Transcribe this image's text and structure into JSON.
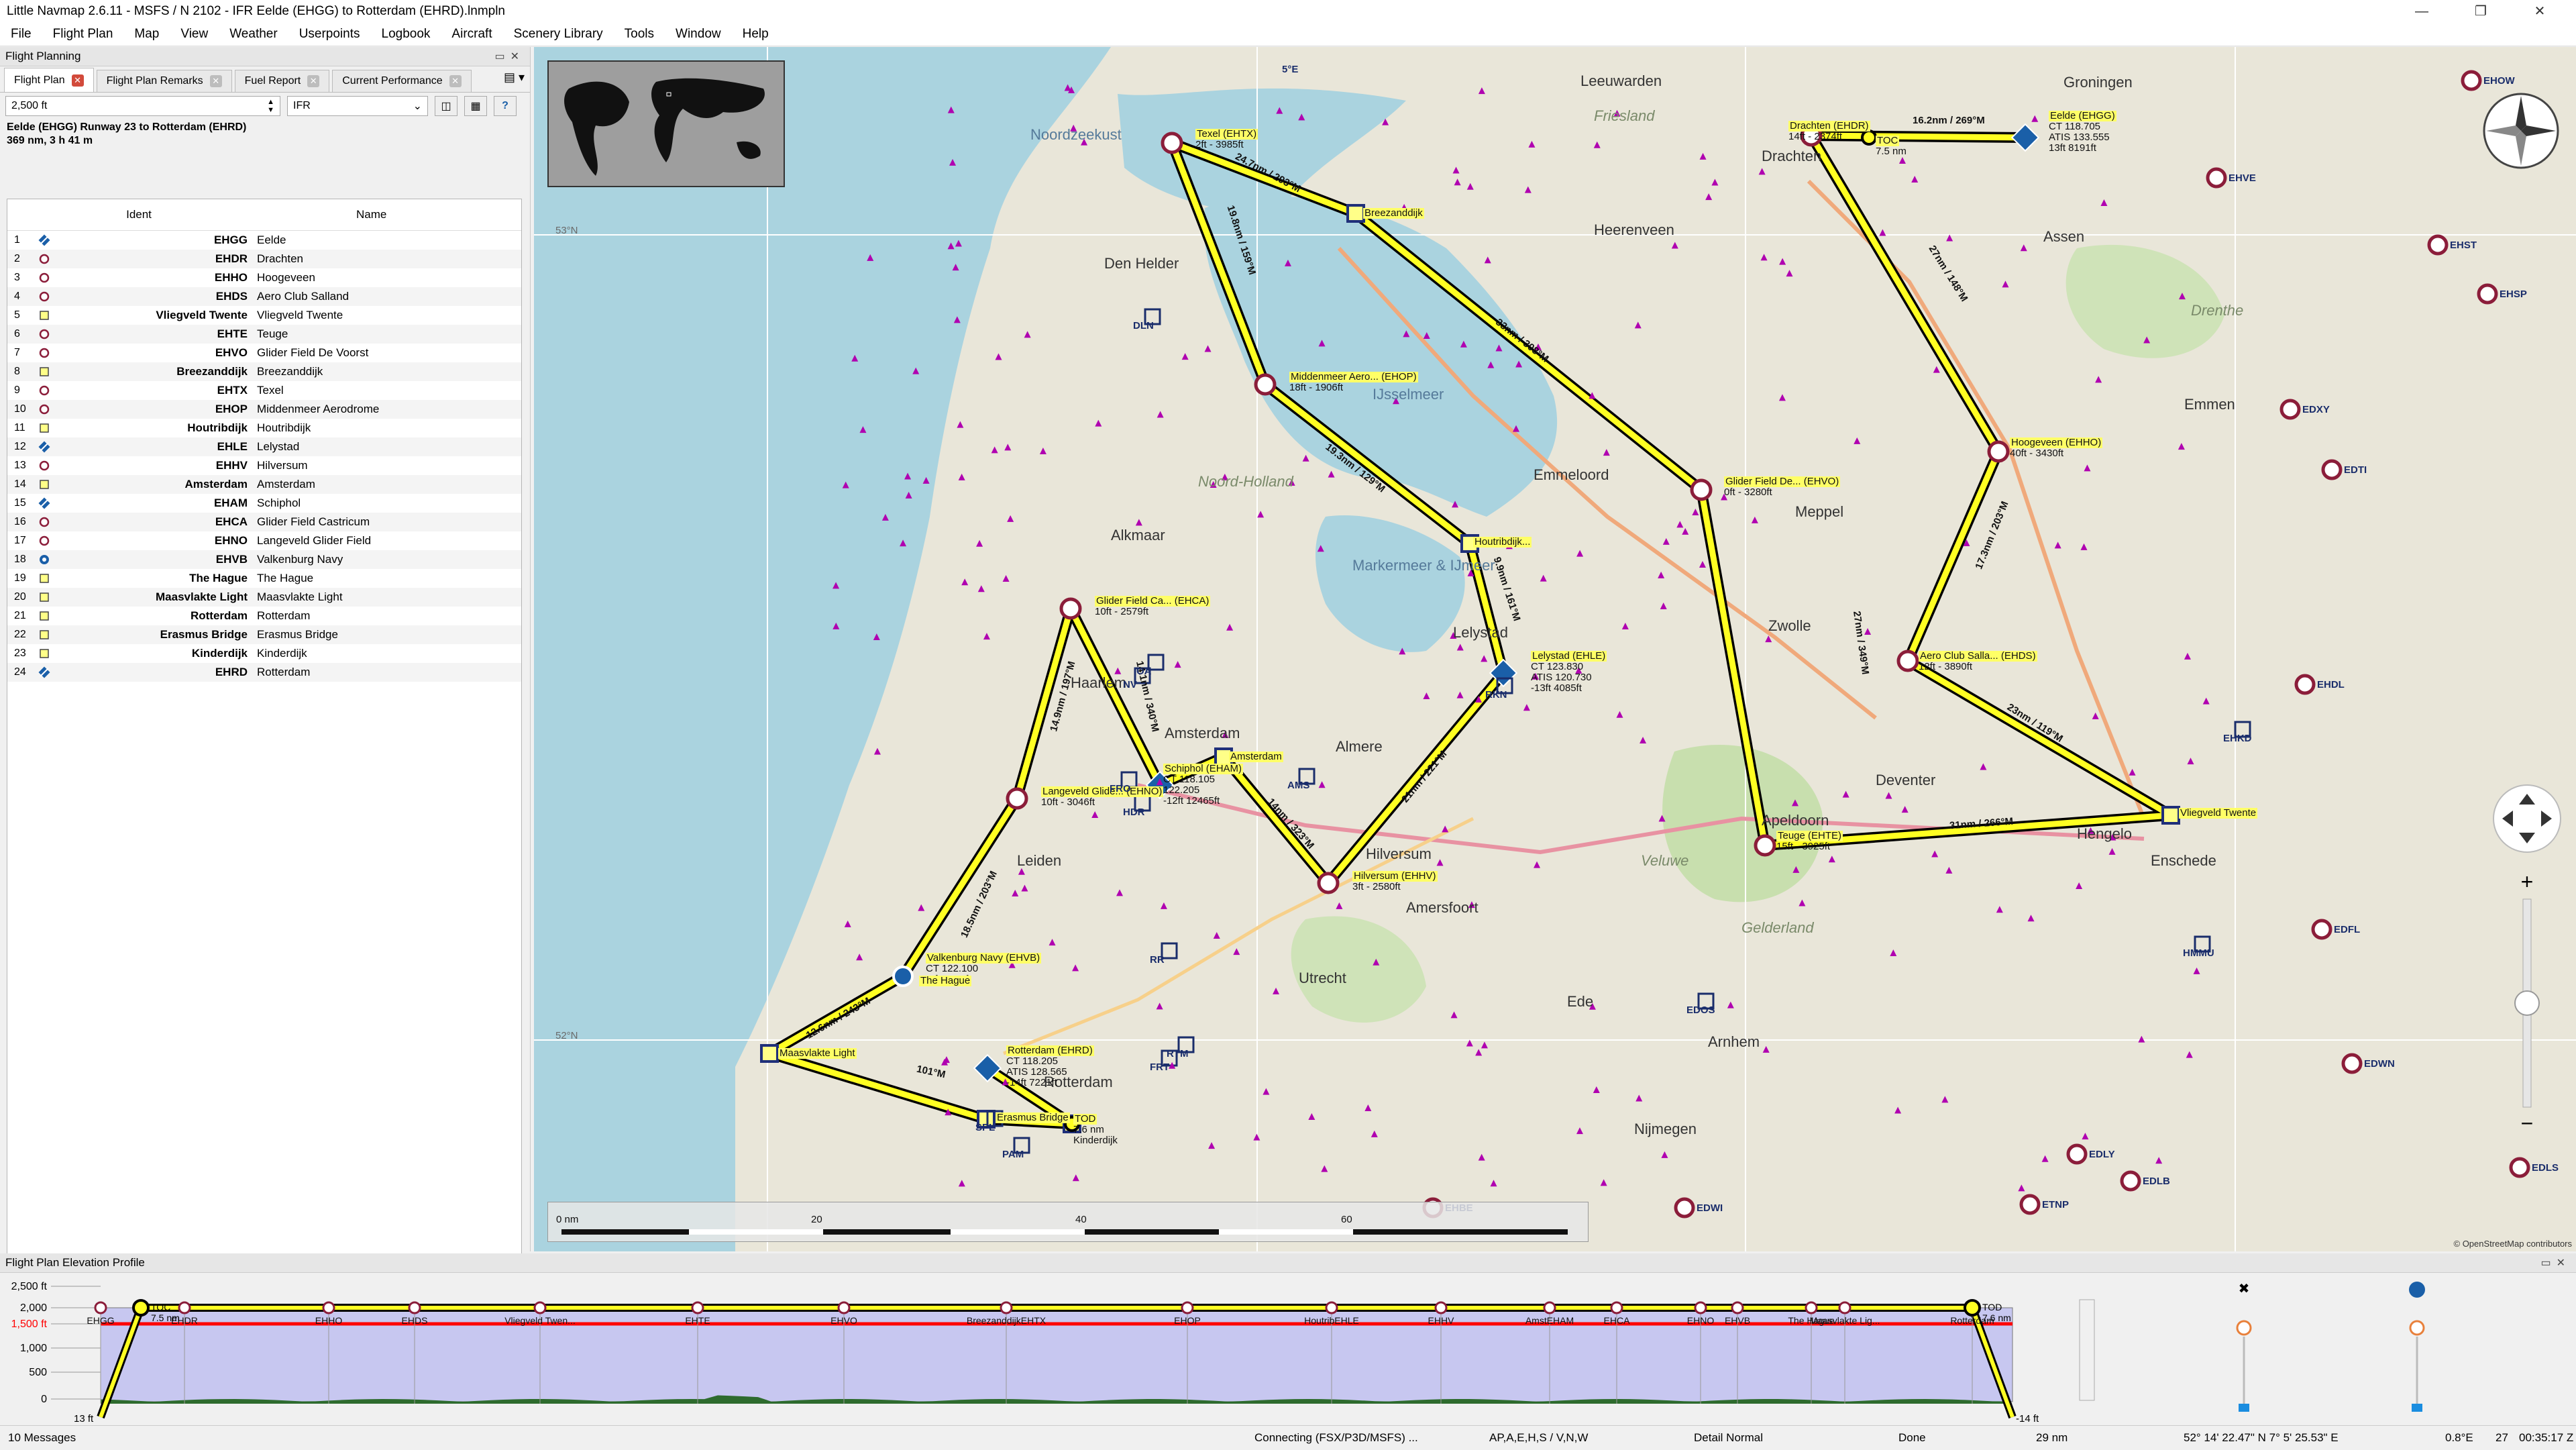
{
  "window": {
    "title": "Little Navmap 2.6.11 - MSFS / N 2102 - IFR Eelde (EHGG) to Rotterdam (EHRD).lnmpln"
  },
  "menu": [
    "File",
    "Flight Plan",
    "Map",
    "View",
    "Weather",
    "Userpoints",
    "Logbook",
    "Aircraft",
    "Scenery Library",
    "Tools",
    "Window",
    "Help"
  ],
  "flight_planning": {
    "panel_title": "Flight Planning",
    "tabs": [
      "Flight Plan",
      "Flight Plan Remarks",
      "Fuel Report",
      "Current Performance"
    ],
    "altitude_value": "2,500 ft",
    "flight_type": "IFR",
    "route_title": "Eelde (EHGG) Runway 23 to Rotterdam (EHRD)",
    "route_summary": "369 nm, 3 h 41 m",
    "columns": {
      "ident": "Ident",
      "name": "Name"
    },
    "rows": [
      {
        "n": "1",
        "ident": "EHGG",
        "name": "Eelde",
        "icon": "airport-towered-icon"
      },
      {
        "n": "2",
        "ident": "EHDR",
        "name": "Drachten",
        "icon": "airfield-icon"
      },
      {
        "n": "3",
        "ident": "EHHO",
        "name": "Hoogeveen",
        "icon": "airfield-icon"
      },
      {
        "n": "4",
        "ident": "EHDS",
        "name": "Aero Club Salland",
        "icon": "airfield-icon"
      },
      {
        "n": "5",
        "ident": "Vliegveld Twente",
        "name": "Vliegveld Twente",
        "icon": "userpoint-icon"
      },
      {
        "n": "6",
        "ident": "EHTE",
        "name": "Teuge",
        "icon": "airfield-icon"
      },
      {
        "n": "7",
        "ident": "EHVO",
        "name": "Glider Field De Voorst",
        "icon": "airfield-icon"
      },
      {
        "n": "8",
        "ident": "Breezanddijk",
        "name": "Breezanddijk",
        "icon": "userpoint-icon"
      },
      {
        "n": "9",
        "ident": "EHTX",
        "name": "Texel",
        "icon": "airfield-icon"
      },
      {
        "n": "10",
        "ident": "EHOP",
        "name": "Middenmeer Aerodrome",
        "icon": "airfield-icon"
      },
      {
        "n": "11",
        "ident": "Houtribdijk",
        "name": "Houtribdijk",
        "icon": "userpoint-icon"
      },
      {
        "n": "12",
        "ident": "EHLE",
        "name": "Lelystad",
        "icon": "airport-towered-icon"
      },
      {
        "n": "13",
        "ident": "EHHV",
        "name": "Hilversum",
        "icon": "airfield-icon"
      },
      {
        "n": "14",
        "ident": "Amsterdam",
        "name": "Amsterdam",
        "icon": "userpoint-icon"
      },
      {
        "n": "15",
        "ident": "EHAM",
        "name": "Schiphol",
        "icon": "airport-towered-icon"
      },
      {
        "n": "16",
        "ident": "EHCA",
        "name": "Glider Field Castricum",
        "icon": "airfield-icon"
      },
      {
        "n": "17",
        "ident": "EHNO",
        "name": "Langeveld Glider Field",
        "icon": "airfield-icon"
      },
      {
        "n": "18",
        "ident": "EHVB",
        "name": "Valkenburg Navy",
        "icon": "military-airport-icon"
      },
      {
        "n": "19",
        "ident": "The Hague",
        "name": "The Hague",
        "icon": "userpoint-icon"
      },
      {
        "n": "20",
        "ident": "Maasvlakte Light",
        "name": "Maasvlakte Light",
        "icon": "userpoint-icon"
      },
      {
        "n": "21",
        "ident": "Rotterdam",
        "name": "Rotterdam",
        "icon": "userpoint-icon"
      },
      {
        "n": "22",
        "ident": "Erasmus Bridge",
        "name": "Erasmus Bridge",
        "icon": "userpoint-icon"
      },
      {
        "n": "23",
        "ident": "Kinderdijk",
        "name": "Kinderdijk",
        "icon": "userpoint-icon"
      },
      {
        "n": "24",
        "ident": "EHRD",
        "name": "Rotterdam",
        "icon": "airport-towered-icon"
      }
    ]
  },
  "map": {
    "scale_labels": [
      "0 nm",
      "20",
      "40",
      "60"
    ],
    "attribution": "© OpenStreetMap contributors",
    "coord_labels": [
      "5°E",
      "53°N",
      "52°N"
    ],
    "cities": [
      "Leeuwarden",
      "Drachten",
      "Groningen",
      "Assen",
      "Emmen",
      "Den Helder",
      "Alkmaar",
      "Haarlem",
      "Amsterdam",
      "Almere",
      "Lelystad",
      "Zwolle",
      "Apeldoorn",
      "Amersfoort",
      "Utrecht",
      "Hilversum",
      "Rotterdam",
      "Arnhem",
      "Nijmegen",
      "Enschede",
      "Hengelo",
      "Deventer",
      "Meppel",
      "Heerenveen",
      "Leiden",
      "Ede",
      "Emmeloord"
    ],
    "regions": [
      "Noord-Holland",
      "Drenthe",
      "Friesland",
      "Gelderland",
      "Veluwe"
    ],
    "seas": [
      "Noordzeekust",
      "Markermeer & IJmeer",
      "IJsselmeer"
    ],
    "airport_labels": [
      {
        "id": "ehtx",
        "lines": [
          "Texel (EHTX)",
          "2ft - 3985ft"
        ]
      },
      {
        "id": "breez",
        "lines": [
          "Breezanddijk"
        ]
      },
      {
        "id": "ehop",
        "lines": [
          "Middenmeer Aero... (EHOP)",
          "18ft - 1906ft"
        ]
      },
      {
        "id": "houtrib",
        "lines": [
          "Houtribdijk..."
        ]
      },
      {
        "id": "ehle",
        "lines": [
          "Lelystad (EHLE)",
          "CT 123.830",
          "ATIS 120.730",
          "-13ft 4085ft"
        ]
      },
      {
        "id": "ehhv",
        "lines": [
          "Hilversum (EHHV)",
          "3ft - 2580ft"
        ]
      },
      {
        "id": "ams",
        "lines": [
          "Amsterdam"
        ]
      },
      {
        "id": "eham",
        "lines": [
          "Schiphol (EHAM)",
          "CT 118.105",
          "122.205",
          "-12ft 12465ft"
        ]
      },
      {
        "id": "ehca",
        "lines": [
          "Glider Field Ca... (EHCA)",
          "10ft - 2579ft"
        ]
      },
      {
        "id": "ehno",
        "lines": [
          "Langeveld Glide... (EHNO)",
          "10ft - 3046ft"
        ]
      },
      {
        "id": "ehvb",
        "lines": [
          "Valkenburg Navy (EHVB)",
          "CT 122.100",
          "-1ft 7990ft"
        ]
      },
      {
        "id": "hague",
        "lines": [
          "The Hague"
        ]
      },
      {
        "id": "maas",
        "lines": [
          "Maasvlakte Light"
        ]
      },
      {
        "id": "ehrd",
        "lines": [
          "Rotterdam (EHRD)",
          "CT 118.205",
          "ATIS 128.565",
          "-14ft 7221ft"
        ]
      },
      {
        "id": "erasmus",
        "lines": [
          "Erasmus Bridge"
        ]
      },
      {
        "id": "kinder",
        "lines": [
          "TOD",
          "7.6 nm",
          "Kinderdijk"
        ]
      },
      {
        "id": "ehdr",
        "lines": [
          "Drachten (EHDR)",
          "14ft - 2374ft"
        ]
      },
      {
        "id": "toc",
        "lines": [
          "TOC",
          "7.5 nm"
        ]
      },
      {
        "id": "ehgg",
        "lines": [
          "Eelde (EHGG)",
          "CT 118.705",
          "ATIS 133.555",
          "13ft 8191ft"
        ]
      },
      {
        "id": "ehho",
        "lines": [
          "Hoogeveen (EHHO)",
          "40ft - 3430ft"
        ]
      },
      {
        "id": "ehvo",
        "lines": [
          "Glider Field De... (EHVO)",
          "0ft - 3280ft"
        ]
      },
      {
        "id": "ehds",
        "lines": [
          "Aero Club Salla... (EHDS)",
          "12ft - 3890ft"
        ]
      },
      {
        "id": "twente",
        "lines": [
          "Vliegveld Twente"
        ]
      },
      {
        "id": "ehte",
        "lines": [
          "Teuge (EHTE)",
          "15ft - 3925ft"
        ]
      }
    ],
    "leg_labels": [
      "16.2nm / 269°M",
      "27nm / 148°M",
      "17.3nm / 203°M",
      "23nm / 119°M",
      "31nm / 266°M",
      "27nm / 349°M",
      "33nm / 308°M",
      "24.7nm / 293°M",
      "19.8nm / 159°M",
      "19.3nm / 129°M",
      "9.9nm / 161°M",
      "21nm / 221°M",
      "14nm / 323°M",
      "14.1nm / 340°M",
      "14.9nm / 197°M",
      "18.5nm / 203°M",
      "12.6nm / 243°M",
      "101°M"
    ],
    "far_labels": [
      "EHOW",
      "EHVE",
      "EHST",
      "EHSP",
      "EDXY",
      "EDTI",
      "EHDL",
      "EHKD",
      "EDFL",
      "EDWN",
      "ETNP",
      "EDWI",
      "EHBE",
      "EDLB",
      "EDLS",
      "EDLY",
      "HMMU",
      "EDOS",
      "RKN",
      "DLN",
      "FRO",
      "HDR",
      "AMS",
      "SPL",
      "PAM",
      "RTM",
      "FRT",
      "RR",
      "NV",
      "OA"
    ]
  },
  "profile": {
    "title": "Flight Plan Elevation Profile",
    "alt_labels": [
      "2,500 ft",
      "2,000",
      "1,500 ft",
      "1,000",
      "500",
      "0"
    ],
    "left_elev": "13 ft",
    "right_elev": "-14 ft",
    "toc": [
      "TOC",
      "7.5 nm"
    ],
    "tod": [
      "TOD",
      "7.6 nm"
    ],
    "waypoints": [
      "EHGG",
      "EHDR",
      "EHHO",
      "EHDS",
      "Vliegveld Twen...",
      "EHTE",
      "EHVO",
      "BreezanddijkEHTX",
      "EHOP",
      "HoutribEHLE",
      "EHHV",
      "AmstEHAM",
      "EHCA",
      "EHNO",
      "EHVB",
      "The Hague",
      "Maasvlakte Lig...",
      "Rotterdam"
    ]
  },
  "status": {
    "messages": "10 Messages",
    "connect": "Connecting (FSX/P3D/MSFS) ...",
    "layers": "AP,A,E,H,S / V,N,W",
    "detail": "Detail Normal",
    "done": "Done",
    "dist": "29 nm",
    "coords": "52° 14' 22.47\" N 7° 5' 25.53\" E",
    "magvar": "0.8°E",
    "frames": "27",
    "time": "00:35:17 Z"
  },
  "colors": {
    "route": "#ffff22",
    "route_outline": "#000000",
    "airport": "#8b1d3a",
    "towered": "#1a5fa8",
    "userpoint": "#1f2f7a",
    "profile_fill": "#c7c7f0",
    "safe_alt": "#ff0000"
  }
}
